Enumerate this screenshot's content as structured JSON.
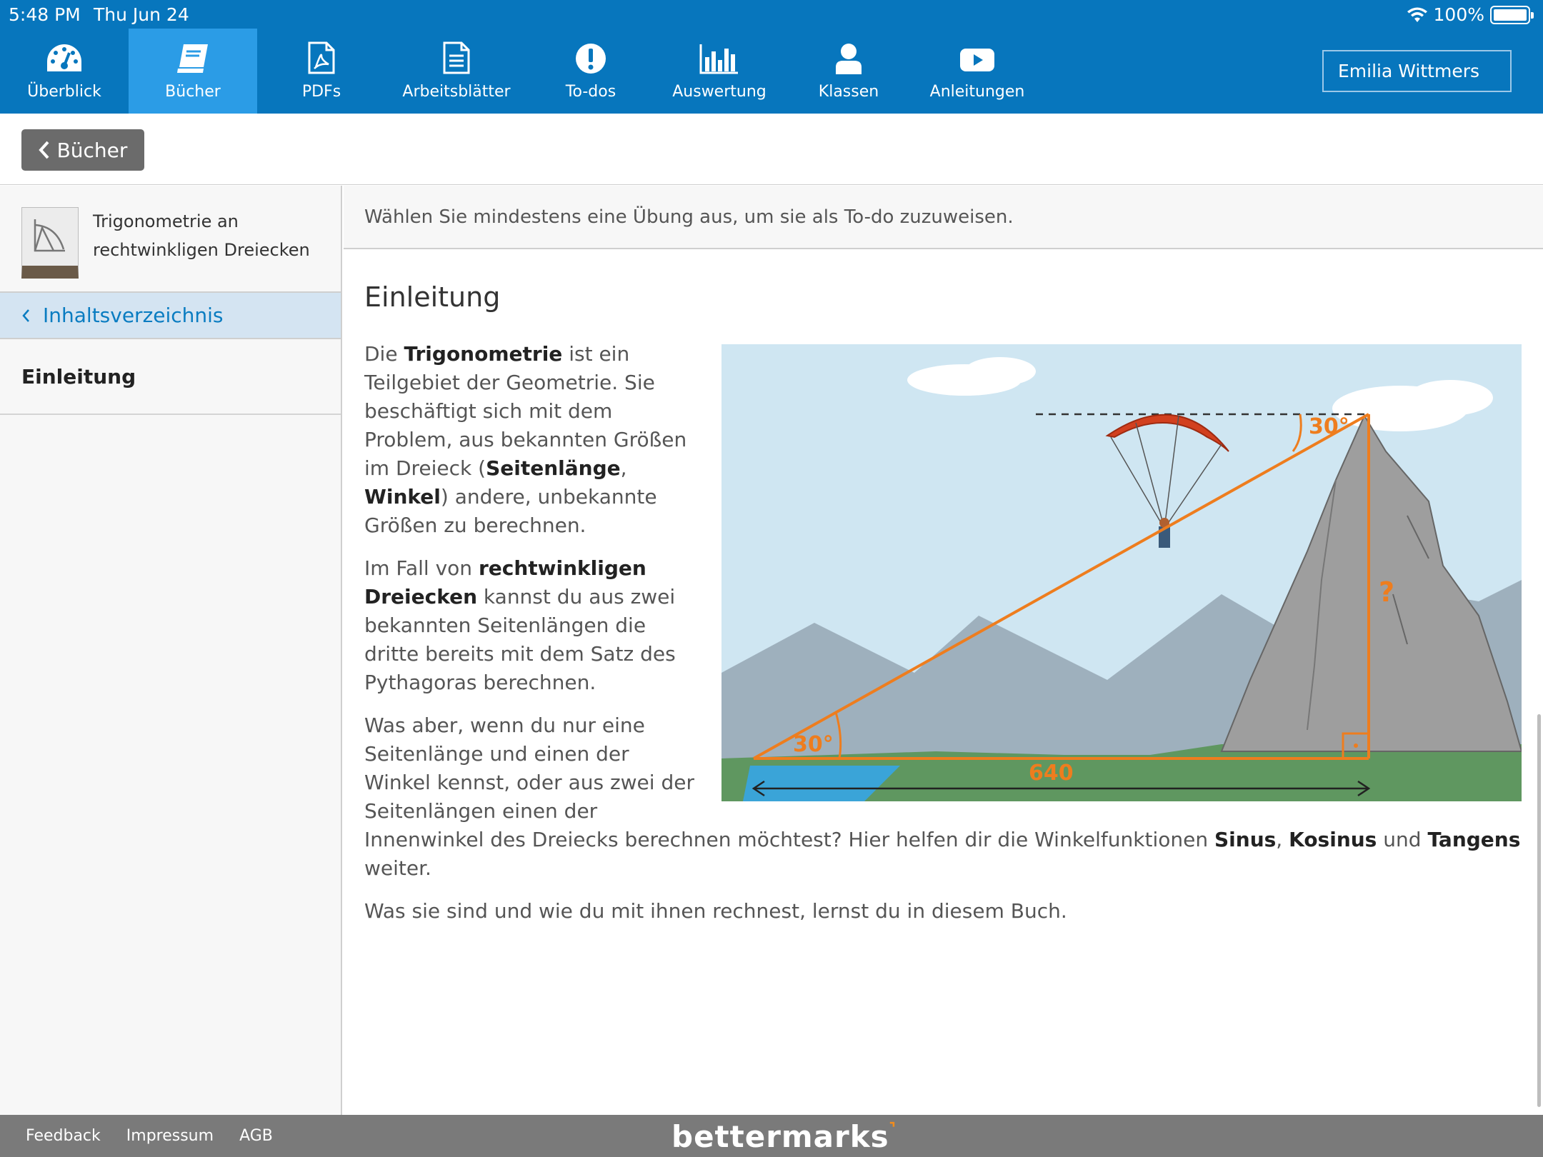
{
  "status_bar": {
    "time": "5:48 PM",
    "date": "Thu Jun 24",
    "battery": "100%"
  },
  "nav": {
    "items": [
      {
        "label": "Überblick",
        "icon": "dashboard-icon"
      },
      {
        "label": "Bücher",
        "icon": "book-icon",
        "active": true
      },
      {
        "label": "PDFs",
        "icon": "pdf-icon"
      },
      {
        "label": "Arbeitsblätter",
        "icon": "worksheet-icon"
      },
      {
        "label": "To-dos",
        "icon": "exclamation-icon"
      },
      {
        "label": "Auswertung",
        "icon": "bar-chart-icon"
      },
      {
        "label": "Klassen",
        "icon": "person-icon"
      },
      {
        "label": "Anleitungen",
        "icon": "video-icon"
      }
    ],
    "user": "Emilia Wittmers"
  },
  "back_button": "Bücher",
  "sidebar": {
    "book_title": "Trigonometrie an rechtwinkligen Dreiecken",
    "toc_link": "Inhaltsverzeichnis",
    "chapter": "Einleitung"
  },
  "notice": "Wählen Sie mindestens eine Übung aus, um sie als To-do zuzuweisen.",
  "content": {
    "heading": "Einleitung",
    "p1": {
      "a": "Die ",
      "b1": "Trigonometrie",
      "c": " ist ein Teilgebiet der Geometrie. Sie beschäftigt sich mit dem Problem, aus bekannten Größen im Dreieck (",
      "b2": "Seitenlänge",
      "d": ", ",
      "b3": "Winkel",
      "e": ") andere, unbekannte Größen zu berechnen."
    },
    "p2": {
      "a": "Im Fall von ",
      "b1": "rechtwinkligen Dreiecken",
      "c": " kannst du aus zwei bekannten Seitenlängen die dritte bereits mit dem Satz des Pythagoras berechnen."
    },
    "p3": {
      "a": "Was aber, wenn du nur eine Seitenlänge und einen der Winkel kennst, oder aus zwei der Seitenlängen einen der Innenwinkel des Dreiecks berechnen möchtest? Hier helfen dir die Winkelfunktionen ",
      "b1": "Sinus",
      "c": ", ",
      "b2": "Kosinus",
      "d": " und ",
      "b3": "Tangens",
      "e": " weiter."
    },
    "p4": "Was sie sind und wie du mit ihnen rechnest, lernst du in diesem Buch.",
    "figure": {
      "angle_bottom": "30°",
      "angle_top": "30°",
      "base": "640",
      "unknown": "?"
    }
  },
  "footer": {
    "links": [
      "Feedback",
      "Impressum",
      "AGB"
    ],
    "logo": "bettermarks"
  },
  "colors": {
    "brand_blue": "#0776bd",
    "active_tab": "#2b9ce6",
    "accent_orange": "#f28c1c"
  }
}
